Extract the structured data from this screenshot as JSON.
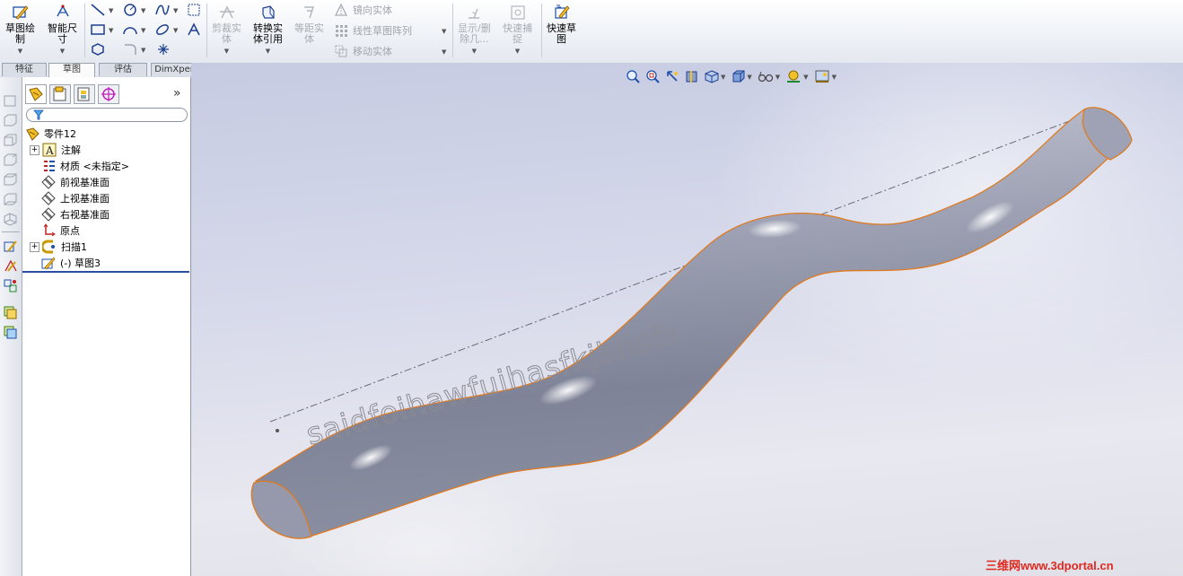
{
  "ribbon": {
    "sketch_label": "草图绘\n制",
    "smart_dim_label": "智能尺\n寸",
    "trim_label": "剪裁实\n体",
    "convert_label": "转换实\n体引用",
    "offset_label": "等距实\n体",
    "mirror_label": "镜向实体",
    "linear_pattern_label": "线性草图阵列",
    "move_label": "移动实体",
    "display_delete_label": "显示/删\n除几...",
    "quick_snap_label": "快速捕\n捉",
    "rapid_sketch_label": "快速草\n图"
  },
  "tabs": [
    "特征",
    "草图",
    "评估",
    "DimXpert"
  ],
  "active_tab": 1,
  "feature_tree": {
    "root": "零件12",
    "items": [
      {
        "label": "注解",
        "expandable": true
      },
      {
        "label": "材质 <未指定>",
        "expandable": false
      },
      {
        "label": "前视基准面",
        "expandable": false
      },
      {
        "label": "上视基准面",
        "expandable": false
      },
      {
        "label": "右视基准面",
        "expandable": false
      },
      {
        "label": "原点",
        "expandable": false
      },
      {
        "label": "扫描1",
        "expandable": true
      },
      {
        "label": "(-) 草图3",
        "expandable": false
      }
    ]
  },
  "panel_expand_glyph": "»",
  "viewport": {
    "overlay_text": "saidfoihawfuihasfkjbhsfs",
    "watermark": "三维网www.3dportal.cn",
    "model_color": "#8f94a6",
    "edge_color": "#e07a20"
  }
}
